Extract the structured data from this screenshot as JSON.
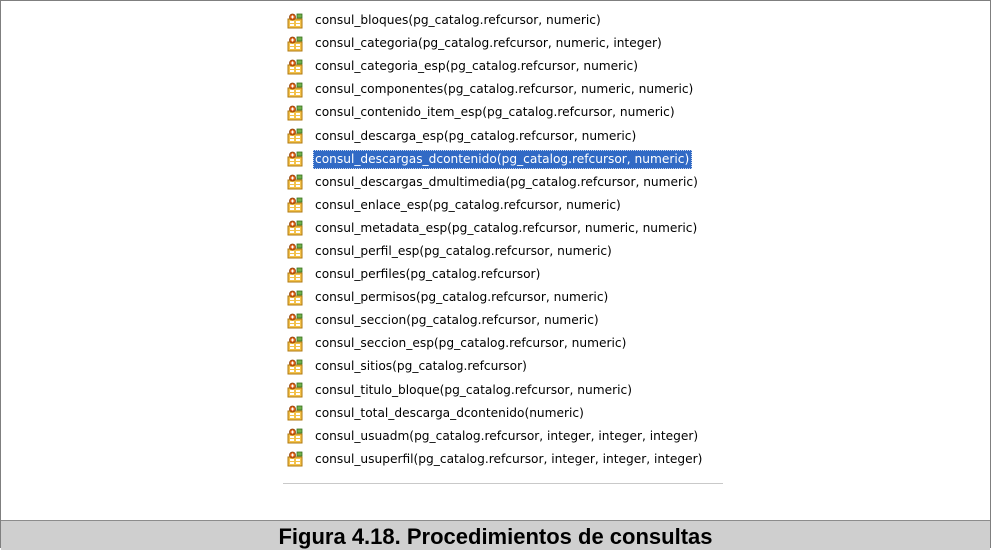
{
  "tree": {
    "icon": "function-icon",
    "selected_index": 6,
    "items": [
      "consul_bloques(pg_catalog.refcursor, numeric)",
      "consul_categoria(pg_catalog.refcursor, numeric, integer)",
      "consul_categoria_esp(pg_catalog.refcursor, numeric)",
      "consul_componentes(pg_catalog.refcursor, numeric, numeric)",
      "consul_contenido_item_esp(pg_catalog.refcursor, numeric)",
      "consul_descarga_esp(pg_catalog.refcursor, numeric)",
      "consul_descargas_dcontenido(pg_catalog.refcursor, numeric)",
      "consul_descargas_dmultimedia(pg_catalog.refcursor, numeric)",
      "consul_enlace_esp(pg_catalog.refcursor, numeric)",
      "consul_metadata_esp(pg_catalog.refcursor, numeric, numeric)",
      "consul_perfil_esp(pg_catalog.refcursor, numeric)",
      "consul_perfiles(pg_catalog.refcursor)",
      "consul_permisos(pg_catalog.refcursor, numeric)",
      "consul_seccion(pg_catalog.refcursor, numeric)",
      "consul_seccion_esp(pg_catalog.refcursor, numeric)",
      "consul_sitios(pg_catalog.refcursor)",
      "consul_titulo_bloque(pg_catalog.refcursor, numeric)",
      "consul_total_descarga_dcontenido(numeric)",
      "consul_usuadm(pg_catalog.refcursor, integer, integer, integer)",
      "consul_usuperfil(pg_catalog.refcursor, integer, integer, integer)"
    ]
  },
  "caption": "Figura 4.18. Procedimientos de consultas"
}
